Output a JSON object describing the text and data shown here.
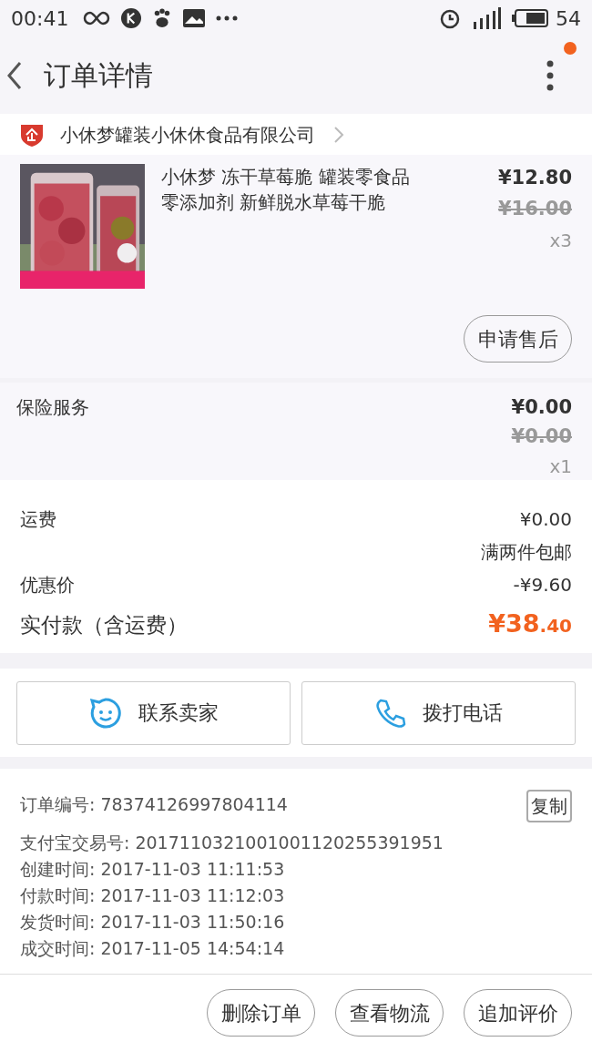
{
  "status_bar": {
    "time": "00:41",
    "battery": "54"
  },
  "header": {
    "title": "订单详情",
    "notification_dot": true
  },
  "shop": {
    "name": "小休梦罐装小休休食品有限公司"
  },
  "product": {
    "title_lines": [
      "小休梦 冻干草莓脆  罐装零食品",
      "零添加剂  新鲜脱水草莓干脆"
    ],
    "price": "¥12.80",
    "original_price": "¥16.00",
    "quantity": "x3",
    "action": "申请售后"
  },
  "insurance": {
    "title": "保险服务",
    "price": "¥0.00",
    "original_price": "¥0.00",
    "quantity": "x1"
  },
  "fees": [
    {
      "label": "运费",
      "value": "¥0.00",
      "note": "满两件包邮"
    },
    {
      "label": "优惠价",
      "value": "-¥9.60"
    }
  ],
  "total": {
    "label": "实付款（含运费）",
    "amount": "¥38.40"
  },
  "contact_buttons": [
    {
      "kind": "chat",
      "label": "联系卖家"
    },
    {
      "kind": "phone",
      "label": "拨打电话"
    }
  ],
  "order_info": {
    "copy_button": "复制",
    "lines": [
      "订单编号: 78374126997804114",
      "支付宝交易号: 2017110321001001120255391951",
      "创建时间: 2017-11-03 11:11:53",
      "付款时间: 2017-11-03 11:12:03",
      "发货时间: 2017-11-03 11:50:16",
      "成交时间: 2017-11-05 14:54:14"
    ]
  },
  "bottom_buttons": [
    "删除订单",
    "查看物流",
    "追加评价"
  ]
}
